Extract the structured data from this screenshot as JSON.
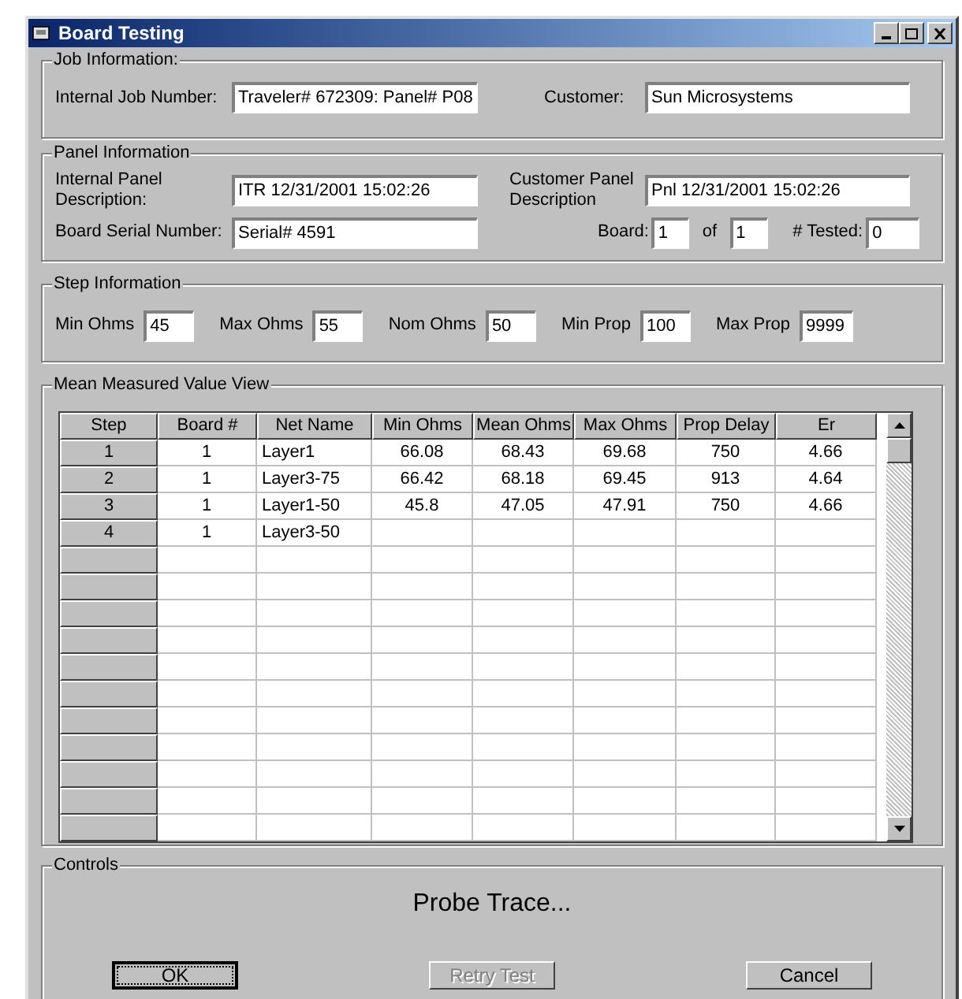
{
  "window": {
    "title": "Board Testing"
  },
  "job_information": {
    "title": "Job Information:",
    "internal_job_number": {
      "label": "Internal Job Number:",
      "value": "Traveler# 672309: Panel# P08"
    },
    "customer": {
      "label": "Customer:",
      "value": "Sun Microsystems"
    }
  },
  "panel_information": {
    "title": "Panel Information",
    "internal_panel_description": {
      "label": "Internal Panel Description:",
      "value": "ITR 12/31/2001 15:02:26"
    },
    "customer_panel_description": {
      "label": "Customer Panel Description",
      "value": "Pnl 12/31/2001 15:02:26"
    },
    "board_serial_number": {
      "label": "Board Serial Number:",
      "value": "Serial# 4591"
    },
    "board": {
      "label": "Board:",
      "value": "1"
    },
    "of": {
      "label": "of",
      "value": "1"
    },
    "tested": {
      "label": "# Tested:",
      "value": "0"
    }
  },
  "step_information": {
    "title": "Step Information",
    "fields": [
      {
        "label": "Min Ohms",
        "value": "45"
      },
      {
        "label": "Max Ohms",
        "value": "55"
      },
      {
        "label": "Nom Ohms",
        "value": "50"
      },
      {
        "label": "Min Prop",
        "value": "100"
      },
      {
        "label": "Max Prop",
        "value": "9999"
      }
    ]
  },
  "mean_measured_value_view": {
    "title": "Mean Measured Value View",
    "table": {
      "columns": [
        "Step",
        "Board #",
        "Net Name",
        "Min Ohms",
        "Mean Ohms",
        "Max Ohms",
        "Prop Delay",
        "Er"
      ],
      "rows": [
        [
          "1",
          "1",
          "Layer1",
          "66.08",
          "68.43",
          "69.68",
          "750",
          "4.66"
        ],
        [
          "2",
          "1",
          "Layer3-75",
          "66.42",
          "68.18",
          "69.45",
          "913",
          "4.64"
        ],
        [
          "3",
          "1",
          "Layer1-50",
          "45.8",
          "47.05",
          "47.91",
          "750",
          "4.66"
        ],
        [
          "4",
          "1",
          "Layer3-50",
          "",
          "",
          "",
          "",
          ""
        ]
      ]
    }
  },
  "controls": {
    "title": "Controls",
    "status": "Probe Trace...",
    "buttons": [
      {
        "label": "OK",
        "disabled": false,
        "default": true
      },
      {
        "label": "Retry Test",
        "disabled": true,
        "default": false
      },
      {
        "label": "Cancel",
        "disabled": false,
        "default": false
      }
    ]
  }
}
